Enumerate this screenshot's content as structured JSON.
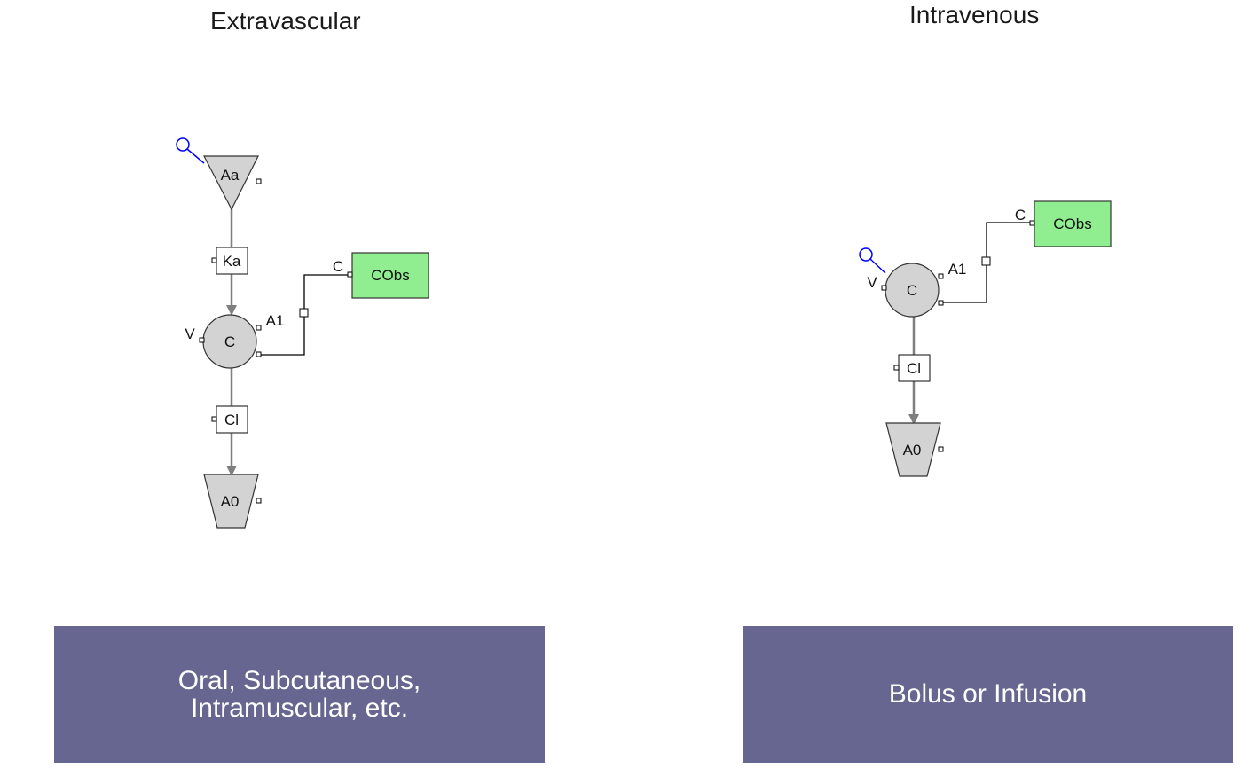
{
  "colors": {
    "route_box": "#666691",
    "observation": "#90ee90",
    "compartment": "#d3d3d3",
    "dose_marker": "#0000ff",
    "flow_line": "#7f7f7f"
  },
  "panels": {
    "extravascular": {
      "title": "Extravascular",
      "route_lines": [
        "Oral, Subcutaneous,",
        "Intramuscular, etc."
      ],
      "nodes": {
        "depot": "Aa",
        "absorption": "Ka",
        "central": "C",
        "clearance": "Cl",
        "elimination": "A0",
        "observation": "CObs"
      },
      "port_labels": {
        "volume": "V",
        "amount": "A1",
        "concentration": "C"
      }
    },
    "intravenous": {
      "title": "Intravenous",
      "route_lines": [
        "Bolus or Infusion"
      ],
      "nodes": {
        "central": "C",
        "clearance": "Cl",
        "elimination": "A0",
        "observation": "CObs"
      },
      "port_labels": {
        "volume": "V",
        "amount": "A1",
        "concentration": "C"
      }
    }
  }
}
